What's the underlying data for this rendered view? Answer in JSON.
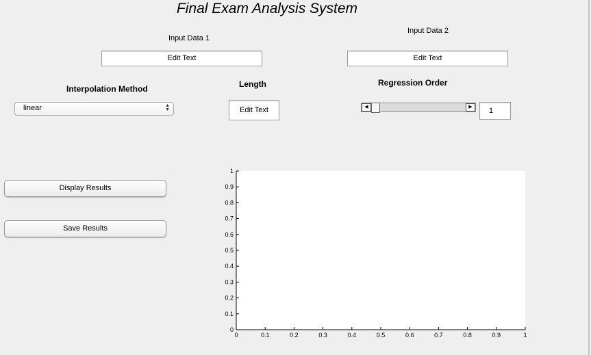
{
  "window": {
    "title": "Final Exam Analysis System"
  },
  "inputs": {
    "data1_label": "Input Data 1",
    "data1_value": "Edit Text",
    "data2_label": "Input Data 2",
    "data2_value": "Edit Text"
  },
  "interpolation": {
    "label": "Interpolation Method",
    "selected": "linear"
  },
  "length": {
    "label": "Length",
    "value": "Edit Text"
  },
  "regression": {
    "label": "Regression Order",
    "slider_value": 0.0,
    "value_display": "1"
  },
  "buttons": {
    "display": "Display Results",
    "save": "Save Results"
  },
  "chart_data": {
    "type": "line",
    "title": "",
    "xlabel": "",
    "ylabel": "",
    "xlim": [
      0,
      1
    ],
    "ylim": [
      0,
      1
    ],
    "x_ticks": [
      "0",
      "0.1",
      "0.2",
      "0.3",
      "0.4",
      "0.5",
      "0.6",
      "0.7",
      "0.8",
      "0.9",
      "1"
    ],
    "y_ticks": [
      "0",
      "0.1",
      "0.2",
      "0.3",
      "0.4",
      "0.5",
      "0.6",
      "0.7",
      "0.8",
      "0.9",
      "1"
    ],
    "series": [],
    "grid": false
  }
}
